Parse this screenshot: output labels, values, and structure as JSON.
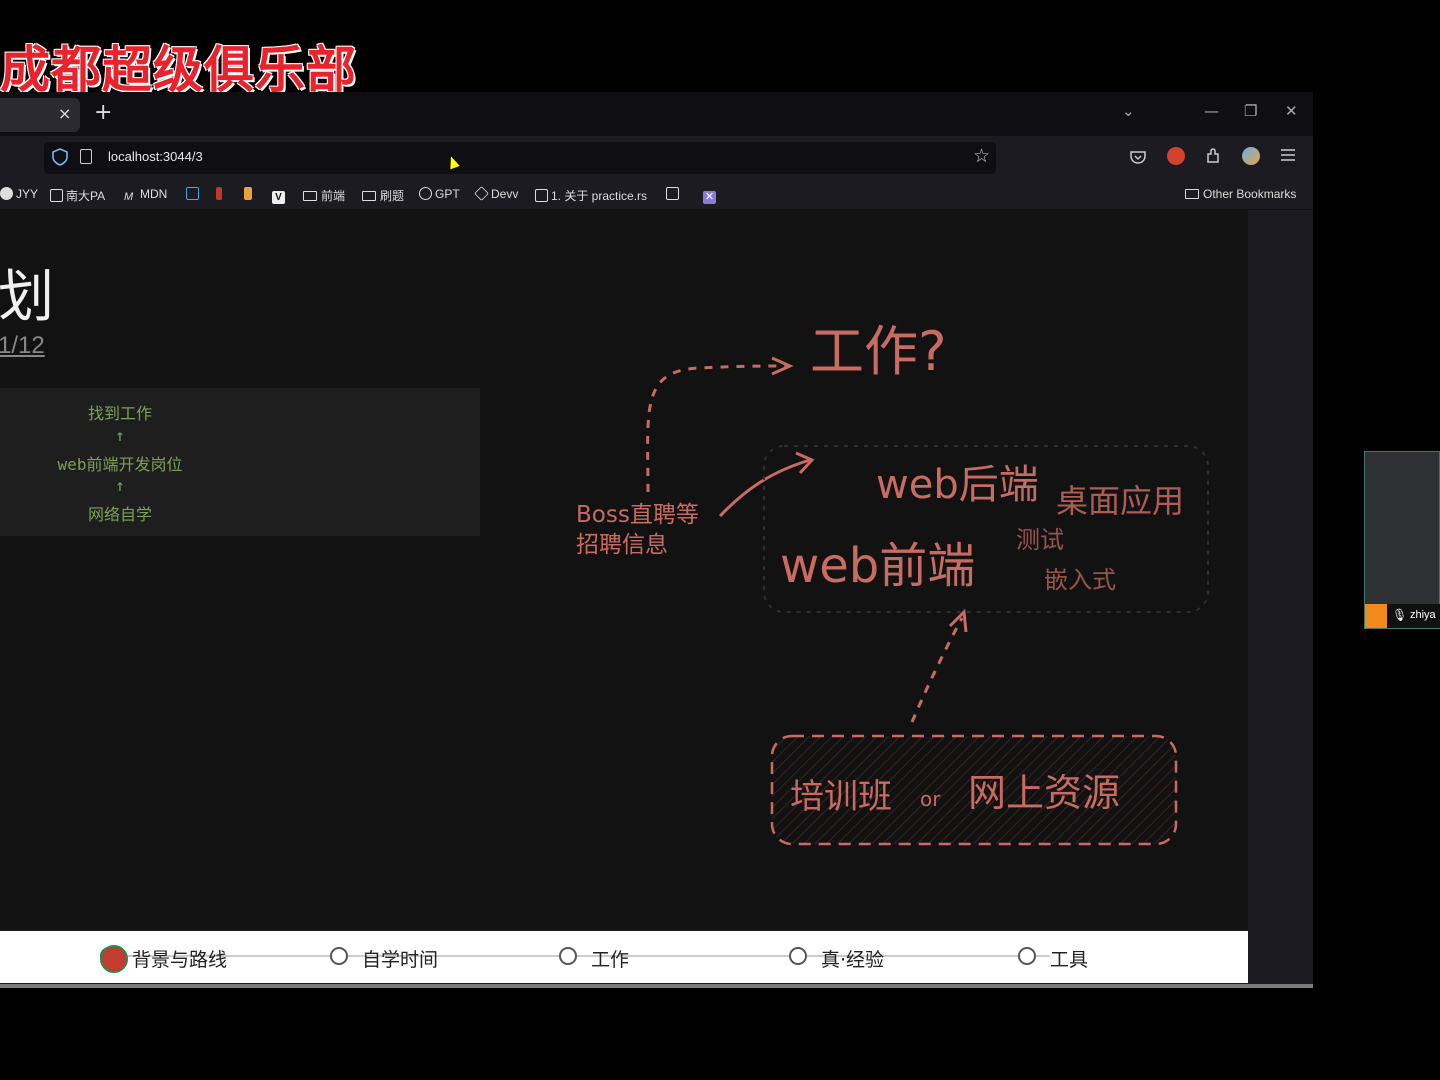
{
  "overlay": {
    "stream_title": "成都超级俱乐部"
  },
  "browser": {
    "tab_close": "×",
    "new_tab": "+",
    "window_controls": {
      "list": "⌄",
      "minimize": "—",
      "restore": "❐",
      "close": "✕"
    },
    "url": "localhost:3044/3",
    "star": "☆",
    "toolbar_icons": [
      "pocket-icon",
      "avatar-icon",
      "extensions-icon",
      "extension-icon",
      "menu-icon"
    ],
    "bookmarks": [
      {
        "label": "JYY",
        "icon": "site-icon"
      },
      {
        "label": "南大PA",
        "icon": "book-icon"
      },
      {
        "label": "MDN",
        "icon": "mdn-icon"
      },
      {
        "label": "",
        "icon": "bilibili-icon"
      },
      {
        "label": "",
        "icon": "figure-icon"
      },
      {
        "label": "",
        "icon": "giraffe-icon"
      },
      {
        "label": "",
        "icon": "v-icon"
      },
      {
        "label": "前端",
        "icon": "folder-icon"
      },
      {
        "label": "刷题",
        "icon": "folder-icon"
      },
      {
        "label": "GPT",
        "icon": "openai-icon"
      },
      {
        "label": "Devv",
        "icon": "cube-icon"
      },
      {
        "label": "1. 关于 practice.rs",
        "icon": "book-icon"
      },
      {
        "label": "",
        "icon": "book-icon"
      },
      {
        "label": "",
        "icon": "x-icon"
      }
    ],
    "other_bookmarks": "Other Bookmarks"
  },
  "slide": {
    "title": "划",
    "date": "1/12",
    "code_lines": [
      "找到工作",
      "↑",
      "web前端开发岗位",
      "↑",
      "网络自学"
    ],
    "sketch": {
      "goal": "工作?",
      "source_line1": "Boss直聘等",
      "source_line2": "招聘信息",
      "web_backend": "web后端",
      "desktop": "桌面应用",
      "web_frontend": "web前端",
      "testing": "测试",
      "embedded": "嵌入式",
      "training": "培训班",
      "or": "or",
      "online": "网上资源"
    }
  },
  "progress": {
    "steps": [
      "背景与路线",
      "自学时间",
      "工作",
      "真·经验",
      "工具"
    ]
  },
  "webcam": {
    "name": "zhiya"
  },
  "colors": {
    "sketch": "#c76b63",
    "code": "#7da05a",
    "overlay": "#e8232b"
  }
}
